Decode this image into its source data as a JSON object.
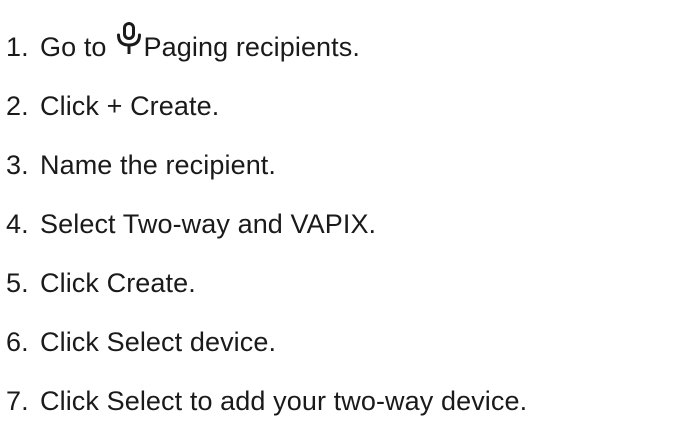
{
  "steps": [
    {
      "number": "1.",
      "text_before": "Go to",
      "icon": "microphone-icon",
      "text_after": "Paging recipients."
    },
    {
      "number": "2.",
      "text": "Click + Create."
    },
    {
      "number": "3.",
      "text": "Name the recipient."
    },
    {
      "number": "4.",
      "text": "Select Two-way and VAPIX."
    },
    {
      "number": "5.",
      "text": "Click Create."
    },
    {
      "number": "6.",
      "text": "Click Select device."
    },
    {
      "number": "7.",
      "text": "Click Select to add your two-way device."
    }
  ]
}
